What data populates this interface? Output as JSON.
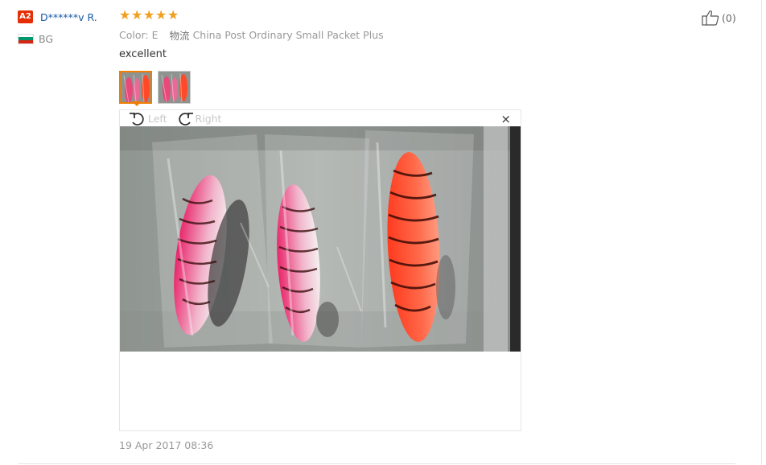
{
  "buyer": {
    "level_badge": "A2",
    "name": "D******v R.",
    "country": "BG",
    "flag_colors": [
      "#ffffff",
      "#00966e",
      "#d62612"
    ]
  },
  "review": {
    "rating": 5,
    "rating_color": "#f0a020",
    "color_label": "Color:",
    "color_value": "E",
    "logistics_label": "物流",
    "logistics_value": "China Post Ordinary Small Packet Plus",
    "feedback_text": "excellent",
    "thumbnails": [
      {
        "active": true,
        "icon": "photo-thumbnail"
      },
      {
        "active": false,
        "icon": "photo-thumbnail"
      }
    ],
    "viewer": {
      "rotate_left_label": "Left",
      "rotate_right_label": "Right",
      "close_glyph": "×"
    },
    "date": "19 Apr 2017 08:36"
  },
  "helpful": {
    "count_label": "(0)",
    "icon": "thumbs-up-icon"
  },
  "colors": {
    "accent_orange": "#f07c00",
    "badge_red": "#e62e04",
    "link_blue": "#1a5aa8"
  }
}
